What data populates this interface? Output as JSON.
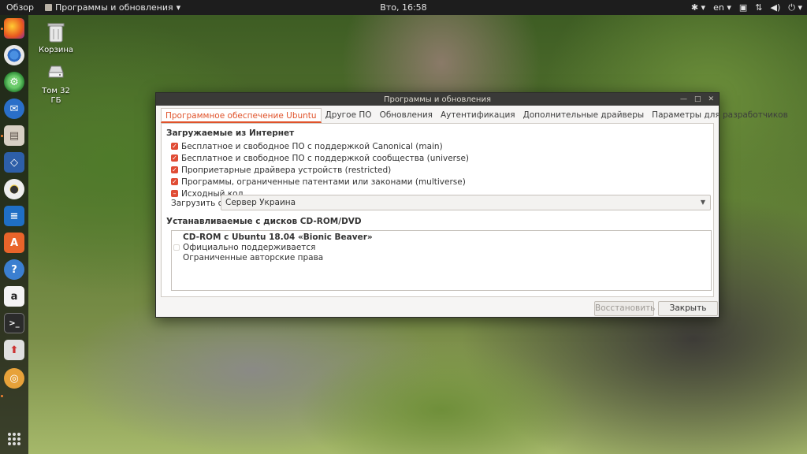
{
  "topbar": {
    "activities": "Обзор",
    "app_menu": "Программы и обновления",
    "clock": "Вто, 16:58",
    "language": "en"
  },
  "dock": {
    "items": [
      "firefox-icon",
      "chromium-icon",
      "settings-icon",
      "thunderbird-icon",
      "files-icon",
      "virtualbox-icon",
      "rhythmbox-icon",
      "libreoffice-writer-icon",
      "ubuntu-software-icon",
      "help-icon",
      "amazon-icon",
      "terminal-icon",
      "update-icon",
      "software-updater-icon"
    ]
  },
  "desktop": {
    "trash_label": "Корзина",
    "volume_label_line1": "Том 32",
    "volume_label_line2": "ГБ"
  },
  "window": {
    "title": "Программы и обновления",
    "tabs": [
      {
        "label": "Программное обеспечение Ubuntu",
        "active": true
      },
      {
        "label": "Другое ПО",
        "active": false
      },
      {
        "label": "Обновления",
        "active": false
      },
      {
        "label": "Аутентификация",
        "active": false
      },
      {
        "label": "Дополнительные драйверы",
        "active": false
      },
      {
        "label": "Параметры для разработчиков",
        "active": false
      }
    ],
    "internet_section": {
      "title": "Загружаемые из Интернет",
      "options": [
        {
          "label": "Бесплатное и свободное ПО с поддержкой Canonical (main)",
          "state": "checked"
        },
        {
          "label": "Бесплатное и свободное ПО с поддержкой сообщества (universe)",
          "state": "checked"
        },
        {
          "label": "Проприетарные драйвера устройств (restricted)",
          "state": "checked"
        },
        {
          "label": "Программы, ограниченные патентами или законами (multiverse)",
          "state": "checked"
        },
        {
          "label": "Исходный код",
          "state": "mixed"
        }
      ]
    },
    "download_from": {
      "label": "Загрузить с:",
      "value": "Сервер Украина"
    },
    "cdrom_section": {
      "title": "Устанавливаемые с дисков CD-ROM/DVD",
      "entry_title": "CD-ROM с Ubuntu 18.04 «Bionic Beaver»",
      "entry_line1": "Официально поддерживается",
      "entry_line2": "Ограниченные авторские права"
    },
    "buttons": {
      "revert": "Восстановить",
      "close": "Закрыть"
    }
  },
  "colors": {
    "accent": "#e0532b",
    "checkbox": "#e04c35",
    "titlebar": "#3a3a38",
    "topbar": "#1d1d1d"
  }
}
